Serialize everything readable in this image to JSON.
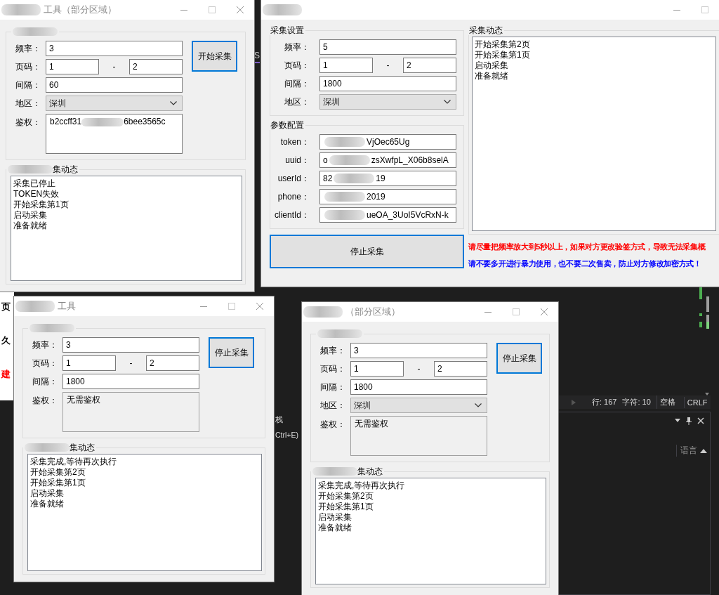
{
  "background": {
    "behind_window": {
      "lines": [
        {
          "text": "页",
          "color": "#000000"
        },
        {
          "text": "久",
          "color": "#000000"
        },
        {
          "text": "建",
          "color": "#ff0000"
        }
      ]
    },
    "editor_tab": {
      "label": "S"
    },
    "side_panel": {
      "lines": [
        "栈",
        "Ctrl+E)"
      ]
    },
    "status_bar": {
      "items": [
        "行: 167",
        "字符: 10",
        "空格",
        "CRLF"
      ]
    },
    "output_panel": {
      "column_header": "语言"
    }
  },
  "windows": [
    {
      "title_parts": [
        {
          "kind": "blur"
        },
        {
          "kind": "text",
          "text": "工具（部分区域）"
        }
      ],
      "controls": [
        {
          "kind": "minimize"
        },
        {
          "kind": "maximize"
        },
        {
          "kind": "close"
        }
      ],
      "groups": [
        {
          "legend_parts": [
            {
              "kind": "blur"
            }
          ],
          "fields": [
            {
              "kind": "text",
              "label": "频率：",
              "value": "3"
            },
            {
              "kind": "range",
              "label": "页码：",
              "from": "1",
              "separator": "-",
              "to": "2"
            },
            {
              "kind": "text",
              "label": "间隔：",
              "value": "60"
            },
            {
              "kind": "select",
              "label": "地区：",
              "value": "深圳"
            },
            {
              "kind": "memo",
              "label": "鉴权：",
              "disabled": false,
              "value_parts": [
                {
                  "kind": "text",
                  "text": "b2ccff31"
                },
                {
                  "kind": "blur"
                },
                {
                  "kind": "text",
                  "text": "6bee3565c"
                }
              ]
            }
          ]
        }
      ],
      "action_button": {
        "label": "开始采集"
      },
      "log": {
        "legend_parts": [
          {
            "kind": "blur"
          },
          {
            "kind": "text",
            "text": "集动态"
          }
        ],
        "items": [
          "采集已停止",
          "TOKEN失效",
          "开始采集第1页",
          "启动采集",
          "准备就绪"
        ]
      }
    },
    {
      "title_parts": [
        {
          "kind": "blur"
        }
      ],
      "controls": [
        {
          "kind": "minimize"
        },
        {
          "kind": "maximize"
        }
      ],
      "groups": [
        {
          "legend_parts": [
            {
              "kind": "text",
              "text": "采集设置"
            }
          ],
          "fields": [
            {
              "kind": "text",
              "label": "频率：",
              "value": "5"
            },
            {
              "kind": "range",
              "label": "页码：",
              "from": "1",
              "separator": "-",
              "to": "2"
            },
            {
              "kind": "text",
              "label": "间隔：",
              "value": "1800"
            },
            {
              "kind": "select",
              "label": "地区：",
              "value": "深圳"
            }
          ]
        },
        {
          "legend_parts": [
            {
              "kind": "text",
              "text": "参数配置"
            }
          ],
          "fields": [
            {
              "kind": "text",
              "label": "token：",
              "value_parts": [
                {
                  "kind": "blur"
                },
                {
                  "kind": "text",
                  "text": "VjOec65Ug"
                }
              ]
            },
            {
              "kind": "text",
              "label": "uuid：",
              "value_parts": [
                {
                  "kind": "text",
                  "text": "o"
                },
                {
                  "kind": "blur"
                },
                {
                  "kind": "text",
                  "text": "zsXwfpL_X06b8selA"
                }
              ]
            },
            {
              "kind": "text",
              "label": "userId：",
              "value_parts": [
                {
                  "kind": "text",
                  "text": "82"
                },
                {
                  "kind": "blur"
                },
                {
                  "kind": "text",
                  "text": "19"
                }
              ]
            },
            {
              "kind": "text",
              "label": "phone：",
              "value_parts": [
                {
                  "kind": "blur"
                },
                {
                  "kind": "text",
                  "text": "2019"
                }
              ]
            },
            {
              "kind": "text",
              "label": "clientId：",
              "value_parts": [
                {
                  "kind": "blur"
                },
                {
                  "kind": "text",
                  "text": "ueOA_3UoI5VcRxN-k"
                }
              ]
            }
          ]
        }
      ],
      "action_button": {
        "label": "停止采集"
      },
      "log": {
        "legend_parts": [
          {
            "kind": "text",
            "text": "采集动态"
          }
        ],
        "items": [
          "开始采集第2页",
          "开始采集第1页",
          "启动采集",
          "准备就绪"
        ]
      },
      "notices": [
        {
          "text": "请尽量把频率放大到5秒以上，如果对方更改验签方式，导致无法采集概",
          "color": "#ff0000"
        },
        {
          "text": "请不要多开进行暴力使用，也不要二次售卖，防止对方修改加密方式！",
          "color": "#0000ff"
        }
      ]
    },
    {
      "title_parts": [
        {
          "kind": "blur"
        },
        {
          "kind": "text",
          "text": "工具"
        }
      ],
      "controls": [
        {
          "kind": "minimize"
        },
        {
          "kind": "maximize"
        },
        {
          "kind": "close"
        }
      ],
      "groups": [
        {
          "legend_parts": [
            {
              "kind": "blur"
            }
          ],
          "fields": [
            {
              "kind": "text",
              "label": "频率：",
              "value": "3"
            },
            {
              "kind": "range",
              "label": "页码：",
              "from": "1",
              "separator": "-",
              "to": "2"
            },
            {
              "kind": "text",
              "label": "间隔：",
              "value": "1800"
            },
            {
              "kind": "memo",
              "label": "鉴权：",
              "disabled": true,
              "value_parts": [
                {
                  "kind": "text",
                  "text": "无需鉴权"
                }
              ]
            }
          ]
        }
      ],
      "action_button": {
        "label": "停止采集"
      },
      "log": {
        "legend_parts": [
          {
            "kind": "blur"
          },
          {
            "kind": "text",
            "text": "集动态"
          }
        ],
        "items": [
          "采集完成,等待再次执行",
          "开始采集第2页",
          "开始采集第1页",
          "启动采集",
          "准备就绪"
        ]
      }
    },
    {
      "title_parts": [
        {
          "kind": "blur"
        },
        {
          "kind": "text",
          "text": "（部分区域）"
        }
      ],
      "controls": [
        {
          "kind": "minimize"
        },
        {
          "kind": "maximize"
        },
        {
          "kind": "close"
        }
      ],
      "groups": [
        {
          "legend_parts": [
            {
              "kind": "blur"
            }
          ],
          "fields": [
            {
              "kind": "text",
              "label": "频率：",
              "value": "3"
            },
            {
              "kind": "range",
              "label": "页码：",
              "from": "1",
              "separator": "-",
              "to": "2"
            },
            {
              "kind": "text",
              "label": "间隔：",
              "value": "1800"
            },
            {
              "kind": "select",
              "label": "地区：",
              "value": "深圳"
            },
            {
              "kind": "memo",
              "label": "鉴权：",
              "disabled": true,
              "value_parts": [
                {
                  "kind": "text",
                  "text": "无需鉴权"
                }
              ]
            }
          ]
        }
      ],
      "action_button": {
        "label": "停止采集"
      },
      "log": {
        "legend_parts": [
          {
            "kind": "blur"
          },
          {
            "kind": "text",
            "text": "集动态"
          }
        ],
        "items": [
          "采集完成,等待再次执行",
          "开始采集第2页",
          "开始采集第1页",
          "启动采集",
          "准备就绪"
        ]
      }
    }
  ]
}
